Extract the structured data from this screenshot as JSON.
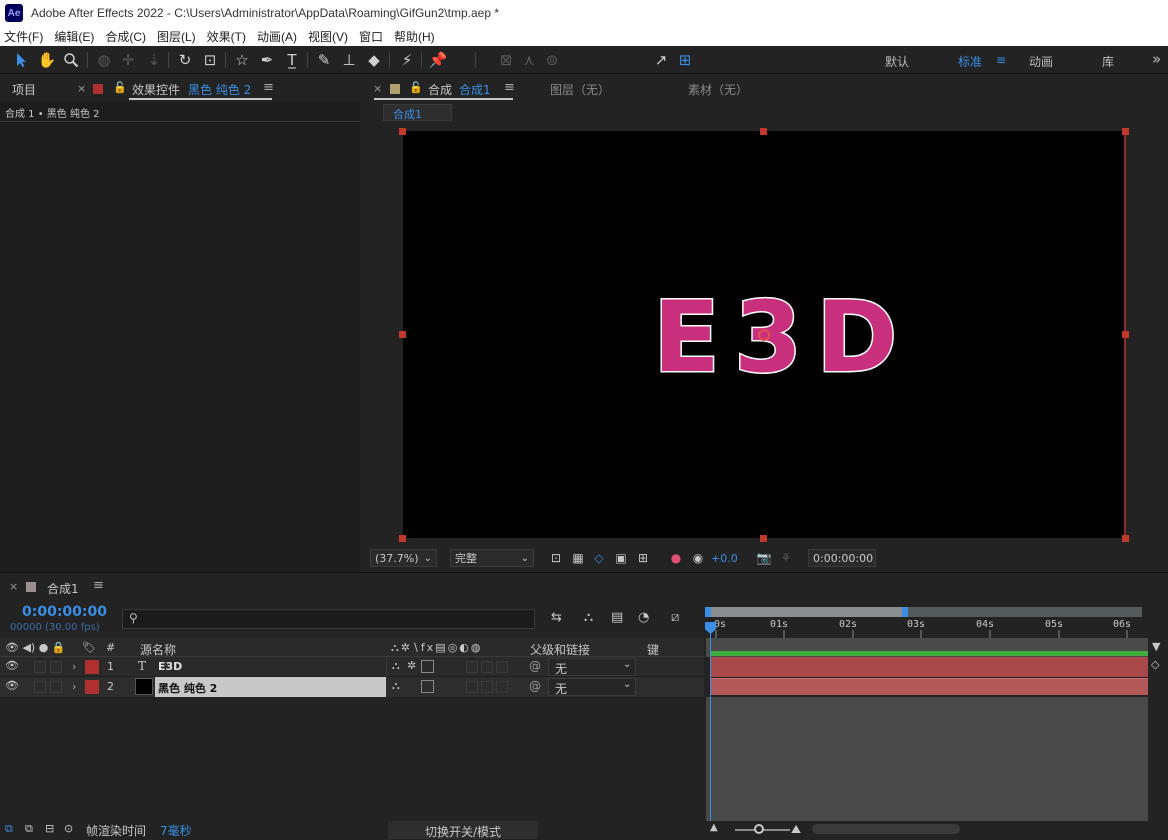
{
  "app": {
    "logo": "Ae",
    "title": "Adobe After Effects 2022 - C:\\Users\\Administrator\\AppData\\Roaming\\GifGun2\\tmp.aep *"
  },
  "menu": [
    "文件(F)",
    "编辑(E)",
    "合成(C)",
    "图层(L)",
    "效果(T)",
    "动画(A)",
    "视图(V)",
    "窗口",
    "帮助(H)"
  ],
  "toolbar": {
    "align_label": "对齐",
    "workspaces": [
      "默认",
      "标准",
      "动画",
      "库"
    ],
    "active_workspace": "标准",
    "more": "»"
  },
  "left_panel": {
    "tab_project": "项目",
    "tab_effects": "效果控件",
    "tab_effects_layer": "黑色 纯色 2",
    "breadcrumb": "合成 1 • 黑色 纯色 2"
  },
  "viewer": {
    "tab_comp": "合成",
    "tab_comp_name": "合成1",
    "tab_layer": "图层（无）",
    "tab_footage": "素材（无）",
    "comp_chip": "合成1",
    "text": "E3D",
    "zoom": "(37.7%)",
    "quality": "完整",
    "exposure": "+0.0",
    "timecode": "0:00:00:00"
  },
  "timeline": {
    "tab": "合成1",
    "timecode": "0:00:00:00",
    "fps": "00000 (30.00 fps)",
    "columns": {
      "hash": "#",
      "source_name": "源名称",
      "parent": "父级和链接",
      "keys": "键"
    },
    "ruler": [
      "0s",
      "01s",
      "02s",
      "03s",
      "04s",
      "05s",
      "06s"
    ],
    "layers": [
      {
        "num": "1",
        "type_icon": "T",
        "name": "E3D",
        "parent": "无",
        "label_color": "#b03030"
      },
      {
        "num": "2",
        "type_icon": "solid",
        "name": "黑色 纯色 2",
        "parent": "无",
        "label_color": "#b03030"
      }
    ],
    "footer": {
      "render_label": "帧渲染时间",
      "render_value": "7毫秒",
      "toggle_label": "切换开关/模式"
    }
  },
  "colors": {
    "accent": "#3a8ee6",
    "text_fill": "#c8307e",
    "layer_bar": "#a84848",
    "green_bar": "#3fae3f"
  }
}
